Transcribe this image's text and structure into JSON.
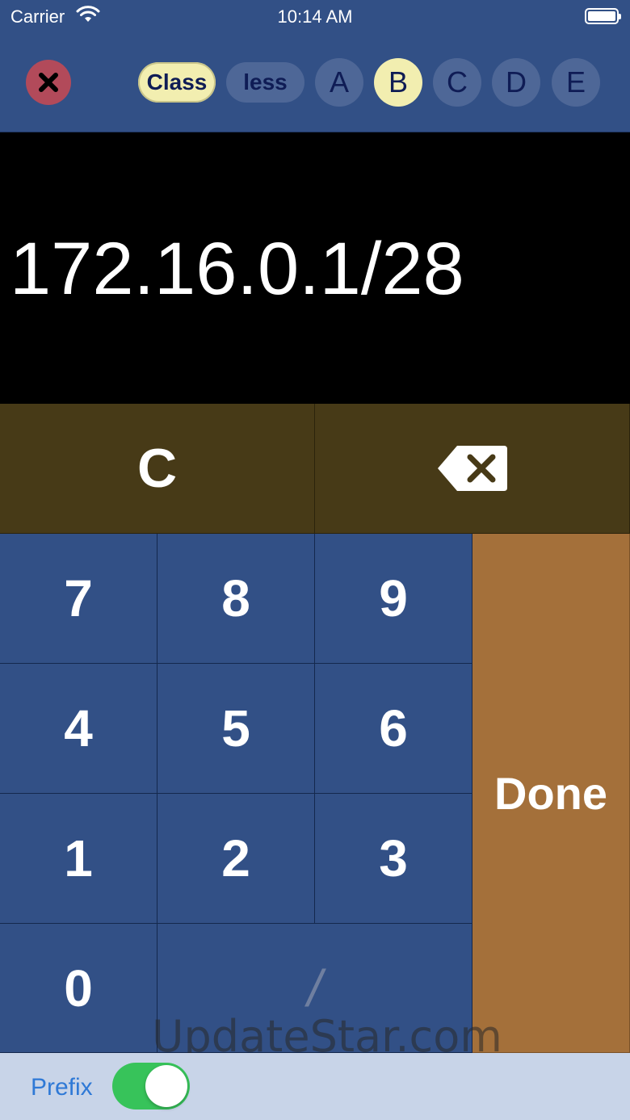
{
  "status_bar": {
    "carrier": "Carrier",
    "time": "10:14 AM",
    "wifi_icon": "wifi-icon",
    "battery_icon": "battery-icon",
    "battery_level": 1.0
  },
  "toolbar": {
    "close_icon": "close-icon",
    "mode_buttons": [
      {
        "label": "Class",
        "selected": true
      },
      {
        "label": "less",
        "selected": false
      }
    ],
    "class_buttons": [
      {
        "label": "A",
        "selected": false
      },
      {
        "label": "B",
        "selected": true
      },
      {
        "label": "C",
        "selected": false
      },
      {
        "label": "D",
        "selected": false
      },
      {
        "label": "E",
        "selected": false
      }
    ]
  },
  "display": {
    "value": "172.16.0.1/28"
  },
  "keypad": {
    "clear_label": "C",
    "backspace_icon": "backspace-icon",
    "keys": {
      "k7": "7",
      "k8": "8",
      "k9": "9",
      "k4": "4",
      "k5": "5",
      "k6": "6",
      "k1": "1",
      "k2": "2",
      "k3": "3",
      "k0": "0",
      "slash": "/"
    },
    "done_label": "Done"
  },
  "watermark": "UpdateStar.com",
  "bottom_bar": {
    "prefix_label": "Prefix",
    "prefix_toggle_on": true
  },
  "colors": {
    "toolbar_bg": "#325086",
    "selected_pill": "#f2eeb0",
    "func_key_bg": "#473a17",
    "done_key_bg": "#a4703a",
    "toggle_on": "#37c35a"
  }
}
